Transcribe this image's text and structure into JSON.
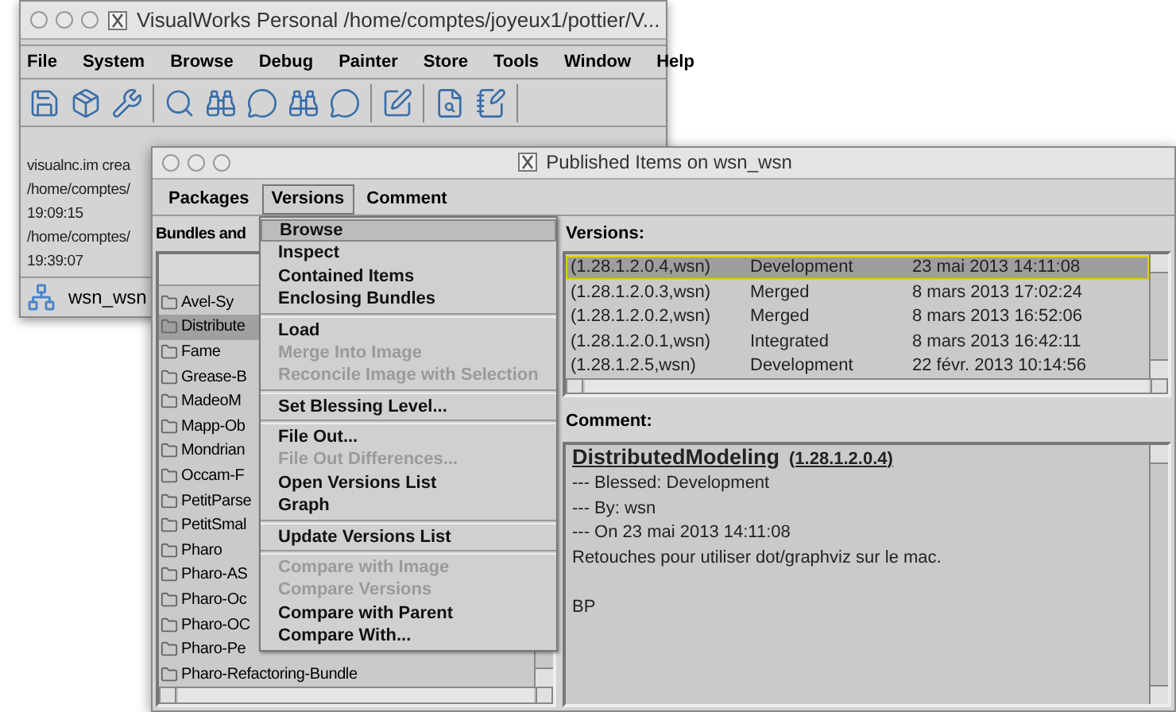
{
  "back_window": {
    "title": "VisualWorks Personal  /home/comptes/joyeux1/pottier/V...",
    "menu": [
      "File",
      "System",
      "Browse",
      "Debug",
      "Painter",
      "Store",
      "Tools",
      "Window",
      "Help"
    ],
    "log": [
      "visualnc.im crea",
      "/home/comptes/",
      "19:09:15",
      "/home/comptes/",
      "19:39:07"
    ],
    "status_bar": "wsn_wsn"
  },
  "front_window": {
    "title": "Published Items on wsn_wsn",
    "menu": [
      {
        "label": "Packages",
        "selected": false
      },
      {
        "label": "Versions",
        "selected": true
      },
      {
        "label": "Comment",
        "selected": false
      }
    ],
    "bundles_label": "Bundles and",
    "bundles": [
      {
        "name": "Avel-Sy",
        "selected": false
      },
      {
        "name": "Distribute",
        "selected": true
      },
      {
        "name": "Fame",
        "selected": false
      },
      {
        "name": "Grease-B",
        "selected": false
      },
      {
        "name": "MadeoM",
        "selected": false
      },
      {
        "name": "Mapp-Ob",
        "selected": false
      },
      {
        "name": "Mondrian",
        "selected": false
      },
      {
        "name": "Occam-F",
        "selected": false
      },
      {
        "name": "PetitParse",
        "selected": false
      },
      {
        "name": "PetitSmal",
        "selected": false
      },
      {
        "name": "Pharo",
        "selected": false
      },
      {
        "name": "Pharo-AS",
        "selected": false
      },
      {
        "name": "Pharo-Oc",
        "selected": false
      },
      {
        "name": "Pharo-OC",
        "selected": false
      },
      {
        "name": "Pharo-Pe",
        "selected": false
      },
      {
        "name": "Pharo-Refactoring-Bundle",
        "selected": false
      }
    ],
    "versions_label": "Versions:",
    "versions": [
      {
        "version": "(1.28.1.2.0.4,wsn)",
        "blessing": "Development",
        "date": "23 mai 2013 14:11:08",
        "selected": true
      },
      {
        "version": "(1.28.1.2.0.3,wsn)",
        "blessing": "Merged",
        "date": "8 mars 2013 17:02:24",
        "selected": false
      },
      {
        "version": "(1.28.1.2.0.2,wsn)",
        "blessing": "Merged",
        "date": "8 mars 2013 16:52:06",
        "selected": false
      },
      {
        "version": "(1.28.1.2.0.1,wsn)",
        "blessing": "Integrated",
        "date": "8 mars 2013 16:42:11",
        "selected": false
      },
      {
        "version": "(1.28.1.2.5,wsn)",
        "blessing": "Development",
        "date": "22 févr. 2013 10:14:56",
        "selected": false
      }
    ],
    "comment_label": "Comment:",
    "comment": {
      "title": "DistributedModeling",
      "version": "(1.28.1.2.0.4)",
      "lines": [
        "--- Blessed: Development",
        "--- By: wsn",
        "--- On 23 mai 2013 14:11:08",
        "Retouches pour utiliser dot/graphviz sur le mac."
      ],
      "signature": "BP"
    },
    "versions_menu": [
      {
        "kind": "item",
        "label": "Browse",
        "selected": true,
        "disabled": false
      },
      {
        "kind": "item",
        "label": "Inspect",
        "selected": false,
        "disabled": false
      },
      {
        "kind": "item",
        "label": "Contained Items",
        "selected": false,
        "disabled": false
      },
      {
        "kind": "item",
        "label": "Enclosing Bundles",
        "selected": false,
        "disabled": false
      },
      {
        "kind": "separator"
      },
      {
        "kind": "item",
        "label": "Load",
        "selected": false,
        "disabled": false
      },
      {
        "kind": "item",
        "label": "Merge Into Image",
        "selected": false,
        "disabled": true
      },
      {
        "kind": "item",
        "label": "Reconcile Image with Selection",
        "selected": false,
        "disabled": true
      },
      {
        "kind": "separator"
      },
      {
        "kind": "item",
        "label": "Set Blessing Level...",
        "selected": false,
        "disabled": false
      },
      {
        "kind": "separator"
      },
      {
        "kind": "item",
        "label": "File Out...",
        "selected": false,
        "disabled": false
      },
      {
        "kind": "item",
        "label": "File Out Differences...",
        "selected": false,
        "disabled": true
      },
      {
        "kind": "item",
        "label": "Open Versions List",
        "selected": false,
        "disabled": false
      },
      {
        "kind": "item",
        "label": "Graph",
        "selected": false,
        "disabled": false
      },
      {
        "kind": "separator"
      },
      {
        "kind": "item",
        "label": "Update Versions List",
        "selected": false,
        "disabled": false
      },
      {
        "kind": "separator"
      },
      {
        "kind": "item",
        "label": "Compare with Image",
        "selected": false,
        "disabled": true
      },
      {
        "kind": "item",
        "label": "Compare Versions",
        "selected": false,
        "disabled": true
      },
      {
        "kind": "item",
        "label": "Compare with Parent",
        "selected": false,
        "disabled": false
      },
      {
        "kind": "item",
        "label": "Compare With...",
        "selected": false,
        "disabled": false
      }
    ]
  }
}
